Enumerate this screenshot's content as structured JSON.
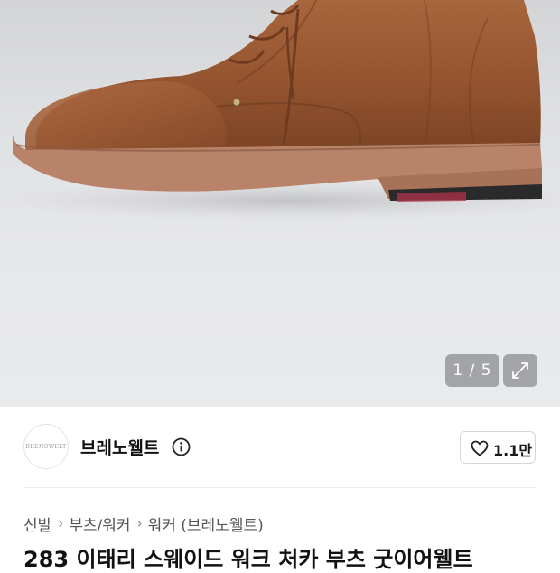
{
  "gallery": {
    "counter": "1 / 5",
    "image_alt": "brown suede boot"
  },
  "brand": {
    "logo_text": "BRENOWELT",
    "name": "브레노웰트"
  },
  "like": {
    "count": "1.1만"
  },
  "breadcrumb": {
    "items": [
      "신발",
      "부츠/워커",
      "워커 (브레노웰트)"
    ]
  },
  "product": {
    "title": "283 이태리 스웨이드 워크 처카 부츠 굿이어웰트"
  },
  "colors": {
    "suede": "#9a5a34",
    "sole": "#b9836a",
    "background": "#e4e5e7"
  }
}
